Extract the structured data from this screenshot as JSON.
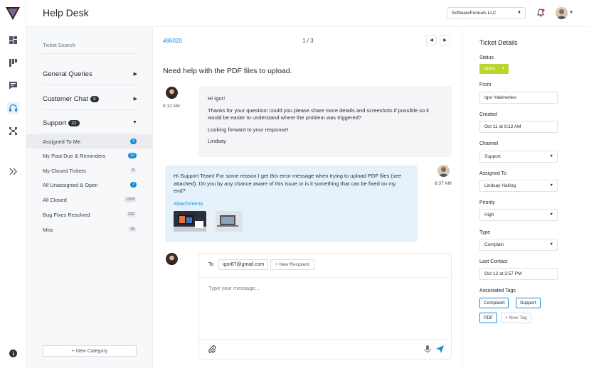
{
  "app": {
    "title": "Help Desk"
  },
  "header": {
    "company": "SoftwareFunnels LLC"
  },
  "rail": {
    "icons": [
      "dashboard-icon",
      "kanban-icon",
      "chat-icon",
      "headset-icon",
      "org-chart-icon",
      "expand-icon",
      "info-icon"
    ]
  },
  "queues": {
    "search_label": "Ticket Search",
    "groups": [
      {
        "label": "General Queries",
        "count": ""
      },
      {
        "label": "Customer Chat",
        "count": "3"
      },
      {
        "label": "Support",
        "count": "22"
      }
    ],
    "items": [
      {
        "label": "Assigned To Me",
        "count": "3",
        "highlight": true
      },
      {
        "label": "My Past Due & Reminders",
        "count": "12",
        "highlight": true
      },
      {
        "label": "My Closed Tickets",
        "count": "5",
        "highlight": false
      },
      {
        "label": "All Unassigned & Open",
        "count": "7",
        "highlight": true
      },
      {
        "label": "All Closed",
        "count": "1293",
        "highlight": false
      },
      {
        "label": "Bug Fixes Resolved",
        "count": "232",
        "highlight": false
      },
      {
        "label": "Misc",
        "count": "19",
        "highlight": false
      }
    ],
    "new_category": "+ New Category"
  },
  "ticket": {
    "id": "#86020",
    "pager": "1 / 3",
    "subject": "Need help with the PDF files to upload.",
    "messages": [
      {
        "time": "9:12 AM",
        "lines": [
          "Hi Igor!",
          "Thanks for your question! could you please share more details and screeshots if possible so it would be easier to understand where the problem was triggered?",
          "Looking forward to your response!",
          "Lindsay"
        ]
      },
      {
        "time": "8:37 AM",
        "text": "Hi Support Team! For some reason I get this error message when trying to upload PDF files (see attached). Do you by any chance aware of this issue or is it something that can be fixed on my end?",
        "attachments_label": "Attachments"
      }
    ],
    "compose": {
      "to_label": "To",
      "recipient": "igor87@gmail.com",
      "new_recipient": "+ New Recipient",
      "placeholder": "Type your message..."
    }
  },
  "details": {
    "title": "Ticket Details",
    "status_label": "Status",
    "status_value": "Open",
    "from_label": "From",
    "from_value": "Igor Yakimenko",
    "created_label": "Created",
    "created_value": "Oct 11 at 9:12 AM",
    "channel_label": "Channel",
    "channel_value": "Support",
    "assigned_label": "Assigned To",
    "assigned_value": "Lindsay Halling",
    "priority_label": "Priority",
    "priority_value": "High",
    "type_label": "Type",
    "type_value": "Complain",
    "last_contact_label": "Last Contact",
    "last_contact_value": "Oct 12 at 3:57 PM",
    "tags_label": "Associated Tags",
    "tags": [
      "Complaint",
      "Support",
      "PDF"
    ],
    "new_tag": "+ New Tag"
  },
  "colors": {
    "accent": "#1a8ad6",
    "status_open": "#b9d52e",
    "notification": "#e0433a"
  }
}
